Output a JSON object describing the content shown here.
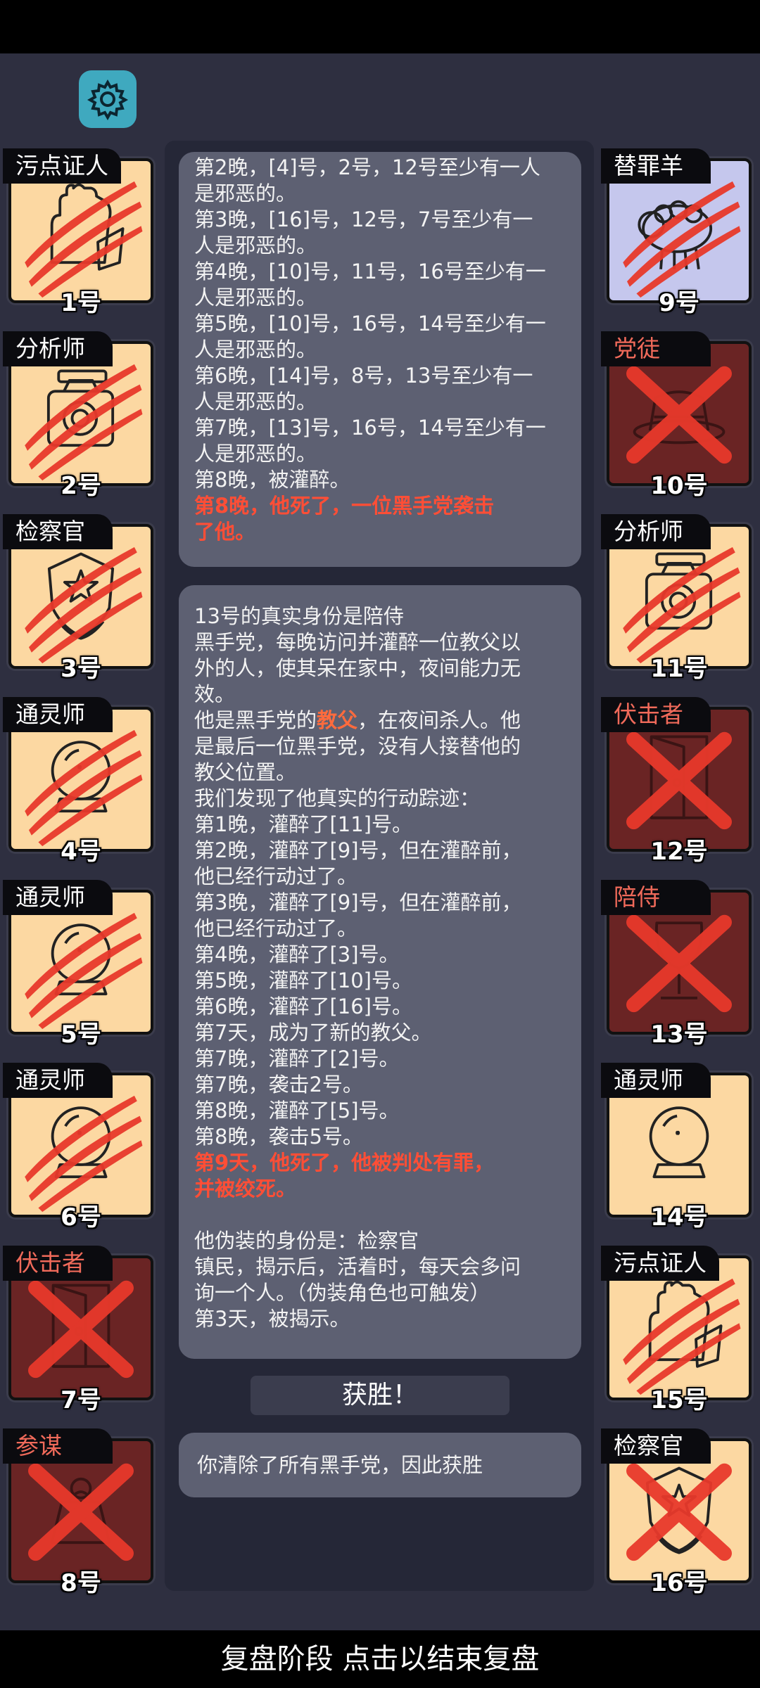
{
  "settings_icon": "gear-icon",
  "left_players": [
    {
      "role": "污点证人",
      "number": "1号",
      "role_color": "white",
      "state": "alive",
      "mark": "scratch",
      "icon": "witness-hand-icon"
    },
    {
      "role": "分析师",
      "number": "2号",
      "role_color": "white",
      "state": "alive",
      "mark": "scratch",
      "icon": "analyst-camera-icon"
    },
    {
      "role": "检察官",
      "number": "3号",
      "role_color": "white",
      "state": "alive",
      "mark": "scratch",
      "icon": "prosecutor-badge-icon"
    },
    {
      "role": "通灵师",
      "number": "4号",
      "role_color": "white",
      "state": "alive",
      "mark": "scratch",
      "icon": "crystal-ball-icon"
    },
    {
      "role": "通灵师",
      "number": "5号",
      "role_color": "white",
      "state": "alive",
      "mark": "scratch",
      "icon": "crystal-ball-icon"
    },
    {
      "role": "通灵师",
      "number": "6号",
      "role_color": "white",
      "state": "alive",
      "mark": "scratch",
      "icon": "crystal-ball-icon"
    },
    {
      "role": "伏击者",
      "number": "7号",
      "role_color": "red",
      "state": "dead",
      "mark": "cross",
      "icon": "door-icon"
    },
    {
      "role": "参谋",
      "number": "8号",
      "role_color": "red",
      "state": "dead",
      "mark": "cross",
      "icon": "consigliere-icon"
    }
  ],
  "right_players": [
    {
      "role": "替罪羊",
      "number": "9号",
      "role_color": "white",
      "state": "blue",
      "mark": "scratch",
      "icon": "sheep-icon"
    },
    {
      "role": "党徒",
      "number": "10号",
      "role_color": "red",
      "state": "dead",
      "mark": "cross",
      "icon": "hat-icon"
    },
    {
      "role": "分析师",
      "number": "11号",
      "role_color": "white",
      "state": "alive",
      "mark": "scratch",
      "icon": "analyst-camera-icon"
    },
    {
      "role": "伏击者",
      "number": "12号",
      "role_color": "red",
      "state": "dead",
      "mark": "cross",
      "icon": "door-icon"
    },
    {
      "role": "陪侍",
      "number": "13号",
      "role_color": "red",
      "state": "dead",
      "mark": "cross",
      "icon": "wine-glass-icon"
    },
    {
      "role": "通灵师",
      "number": "14号",
      "role_color": "white",
      "state": "alive",
      "mark": "none",
      "icon": "crystal-ball-icon"
    },
    {
      "role": "污点证人",
      "number": "15号",
      "role_color": "white",
      "state": "alive",
      "mark": "scratch",
      "icon": "witness-hand-icon"
    },
    {
      "role": "检察官",
      "number": "16号",
      "role_color": "white",
      "state": "alive",
      "mark": "cross",
      "icon": "prosecutor-badge-icon"
    }
  ],
  "log1": {
    "lines": [
      "第2晚，[4]号，2号，12号至少有一人",
      "是邪恶的。",
      "第3晚，[16]号，12号，7号至少有一",
      "人是邪恶的。",
      "第4晚，[10]号，11号，16号至少有一",
      "人是邪恶的。",
      "第5晚，[10]号，16号，14号至少有一",
      "人是邪恶的。",
      "第6晚，[14]号，8号，13号至少有一",
      "人是邪恶的。",
      "第7晚，[13]号，16号，14号至少有一",
      "人是邪恶的。",
      "第8晚，被灌醉。"
    ],
    "death_line1": "第8晚，他死了，一位黑手党袭击",
    "death_line2": "了他。"
  },
  "log2": {
    "intro": [
      "13号的真实身份是陪侍",
      "黑手党，每晚访问并灌醉一位教父以",
      "外的人，使其呆在家中，夜间能力无",
      "效。"
    ],
    "godfather_prefix": "他是黑手党的",
    "godfather_word": "教父",
    "godfather_suffix": "，在夜间杀人。他",
    "mid": [
      "是最后一位黑手党，没有人接替他的",
      "教父位置。",
      "我们发现了他真实的行动踪迹：",
      "第1晚，灌醉了[11]号。",
      "第2晚，灌醉了[9]号，但在灌醉前，",
      "他已经行动过了。",
      "第3晚，灌醉了[9]号，但在灌醉前，",
      "他已经行动过了。",
      "第4晚，灌醉了[3]号。",
      "第5晚，灌醉了[10]号。",
      "第6晚，灌醉了[16]号。",
      "第7天，成为了新的教父。",
      "第7晚，灌醉了[2]号。",
      "第7晚，袭击2号。",
      "第8晚，灌醉了[5]号。",
      "第8晚，袭击5号。"
    ],
    "death_line1": "第9天，他死了，他被判处有罪，",
    "death_line2": "并被绞死。",
    "disguise": [
      "他伪装的身份是：检察官",
      "镇民，揭示后，活着时，每天会多问",
      "询一个人。（伪装角色也可触发）",
      "第3天，被揭示。"
    ]
  },
  "victory_label": "获胜！",
  "result_text": "你清除了所有黑手党，因此获胜",
  "bottom_bar_text": "复盘阶段 点击以结束复盘",
  "colors": {
    "background": "#2e2f40",
    "alive_card": "#fcd8a2",
    "dead_card": "#6a2424",
    "scapegoat_card": "#c5c7ed",
    "mark_red": "#e8392b",
    "log_red": "#ff4e36"
  }
}
